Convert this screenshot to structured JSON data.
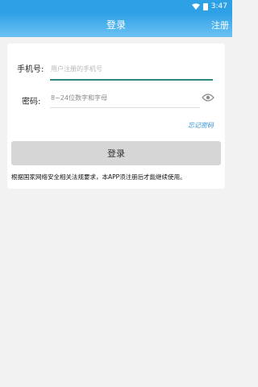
{
  "status_bar": {
    "time": "3:47"
  },
  "header": {
    "title": "登录",
    "register_label": "注册"
  },
  "form": {
    "phone": {
      "label": "手机号:",
      "placeholder": "用户注册的手机号",
      "value": ""
    },
    "password": {
      "label": "密码:",
      "placeholder": "8~24位数字和字母",
      "value": ""
    },
    "forgot_label": "忘记密码",
    "login_label": "登录",
    "notice": "根据国家网络安全相关法规要求，本APP须注册后才能继续使用。"
  },
  "colors": {
    "accent": "#2ea1e6",
    "input_focus": "#2b8a7c",
    "link": "#2e8fd6",
    "button_disabled": "#d6d6d6",
    "background": "#f2f2f2"
  },
  "icons": [
    "wifi-icon",
    "battery-icon",
    "eye-icon"
  ]
}
